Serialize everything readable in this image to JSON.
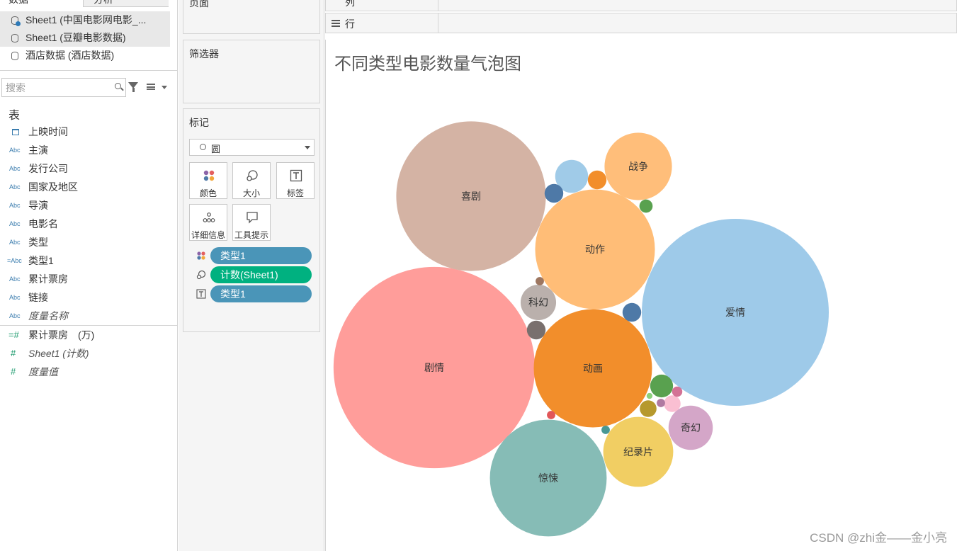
{
  "tabs": {
    "data": "数据",
    "analysis": "分析"
  },
  "sources": [
    {
      "label": "Sheet1 (中国电影网电影_..."
    },
    {
      "label": "Sheet1 (豆瓣电影数据)"
    },
    {
      "label": "酒店数据 (酒店数据)"
    }
  ],
  "search": {
    "placeholder": "搜索"
  },
  "table_heading": "表",
  "dimensions": [
    {
      "type": "date",
      "name": "上映时间"
    },
    {
      "type": "Abc",
      "name": "主演"
    },
    {
      "type": "Abc",
      "name": "发行公司"
    },
    {
      "type": "Abc",
      "name": "国家及地区"
    },
    {
      "type": "Abc",
      "name": "导演"
    },
    {
      "type": "Abc",
      "name": "电影名"
    },
    {
      "type": "Abc",
      "name": "类型"
    },
    {
      "type": "=Abc",
      "name": "类型1"
    },
    {
      "type": "Abc",
      "name": "累计票房"
    },
    {
      "type": "Abc",
      "name": "链接"
    },
    {
      "type": "Abc",
      "name": "度量名称"
    }
  ],
  "measures": [
    {
      "type": "=#",
      "name": "累计票房　(万)"
    },
    {
      "type": "#",
      "name": "Sheet1 (计数)"
    },
    {
      "type": "#",
      "name": "度量值"
    }
  ],
  "cards": {
    "pages_title": "页面",
    "filters_title": "筛选器",
    "marks_title": "标记",
    "mark_type": "圆",
    "buttons": {
      "color": "颜色",
      "size": "大小",
      "label": "标签",
      "detail": "详细信息",
      "tooltip": "工具提示"
    },
    "pills": [
      {
        "role": "color",
        "label": "类型1",
        "bg": "#4a95b8"
      },
      {
        "role": "size",
        "label": "计数(Sheet1)",
        "bg": "#00b180"
      },
      {
        "role": "label",
        "label": "类型1",
        "bg": "#4a95b8"
      }
    ]
  },
  "shelves": {
    "columns_label": "列",
    "rows_label": "行"
  },
  "view": {
    "title": "不同类型电影数量气泡图"
  },
  "watermark": "CSDN @zhi金——金小亮",
  "chart_data": {
    "type": "bubble",
    "title": "不同类型电影数量气泡图",
    "color_by": "类型1",
    "size_by": "计数(Sheet1)",
    "bubbles": [
      {
        "label": "爱情",
        "relative_size": 1.0,
        "color": "#9ecae9"
      },
      {
        "label": "剧情",
        "relative_size": 1.16,
        "color": "#ff9d9a"
      },
      {
        "label": "喜剧",
        "relative_size": 0.64,
        "color": "#d4b3a4"
      },
      {
        "label": "动作",
        "relative_size": 0.41,
        "color": "#ffbd77"
      },
      {
        "label": "动画",
        "relative_size": 0.4,
        "color": "#f28e2b"
      },
      {
        "label": "惊悚",
        "relative_size": 0.39,
        "color": "#86bcb6"
      },
      {
        "label": "纪录片",
        "relative_size": 0.14,
        "color": "#f1ce63"
      },
      {
        "label": "战争",
        "relative_size": 0.13,
        "color": "#ffbe7a"
      },
      {
        "label": "奇幻",
        "relative_size": 0.056,
        "color": "#d4a6c8"
      },
      {
        "label": "科幻",
        "relative_size": 0.036,
        "color": "#bab0ac"
      },
      {
        "label": "",
        "relative_size": 0.031,
        "color": "#a0cbe8"
      },
      {
        "label": "",
        "relative_size": 0.015,
        "color": "#59a14f"
      },
      {
        "label": "",
        "relative_size": 0.01,
        "color": "#4e79a7"
      },
      {
        "label": "",
        "relative_size": 0.01,
        "color": "#4e79a7"
      },
      {
        "label": "",
        "relative_size": 0.01,
        "color": "#79706e"
      },
      {
        "label": "",
        "relative_size": 0.01,
        "color": "#f28e2b"
      },
      {
        "label": "",
        "relative_size": 0.008,
        "color": "#b6992d"
      },
      {
        "label": "",
        "relative_size": 0.008,
        "color": "#fabfd2"
      },
      {
        "label": "",
        "relative_size": 0.005,
        "color": "#59a14f"
      },
      {
        "label": "",
        "relative_size": 0.003,
        "color": "#d37295"
      },
      {
        "label": "",
        "relative_size": 0.002,
        "color": "#e15759"
      },
      {
        "label": "",
        "relative_size": 0.002,
        "color": "#9d7660"
      },
      {
        "label": "",
        "relative_size": 0.002,
        "color": "#499894"
      },
      {
        "label": "",
        "relative_size": 0.002,
        "color": "#b07aa1"
      },
      {
        "label": "",
        "relative_size": 0.001,
        "color": "#8cd17d"
      }
    ]
  }
}
